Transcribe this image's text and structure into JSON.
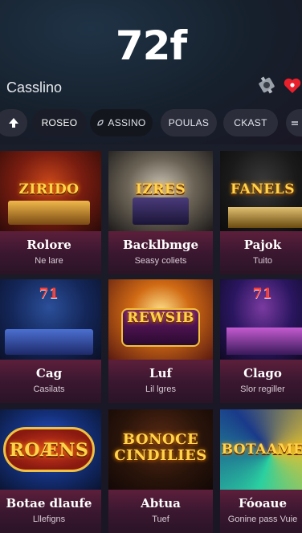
{
  "app": {
    "logo": "72f",
    "subtitle": "Casslino"
  },
  "icons": {
    "settings": "gear-icon",
    "favorite": "heart-icon",
    "accent": "#e8202c"
  },
  "chips": [
    {
      "label": ""
    },
    {
      "label": "ROSEO"
    },
    {
      "label": "ASSINO"
    },
    {
      "label": "POULAS"
    },
    {
      "label": "CKAST"
    },
    {
      "label": ""
    }
  ],
  "games": [
    {
      "art_title": "ZIRIDO",
      "name": "Rolore",
      "sub": "Ne lare"
    },
    {
      "art_title": "IZRES",
      "name": "Backlbmge",
      "sub": "Seasy coliets"
    },
    {
      "art_title": "FANELS",
      "name": "Pajok",
      "sub": "Tuito"
    },
    {
      "art_title": "71",
      "name": "Cag",
      "sub": "Casilats"
    },
    {
      "art_title": "REWSIB",
      "name": "Luf",
      "sub": "Lil lgres"
    },
    {
      "art_title": "71",
      "name": "Clago",
      "sub": "Slor regiller"
    },
    {
      "art_title": "ROÆNS",
      "name": "Botae dlaufe",
      "sub": "Lllefigns"
    },
    {
      "art_title": "BONOCE CINDILIES",
      "name": "Abtua",
      "sub": "Tuef"
    },
    {
      "art_title": "BOTAAME",
      "name": "Fóoaue",
      "sub": "Gonine pass Vuie"
    }
  ]
}
